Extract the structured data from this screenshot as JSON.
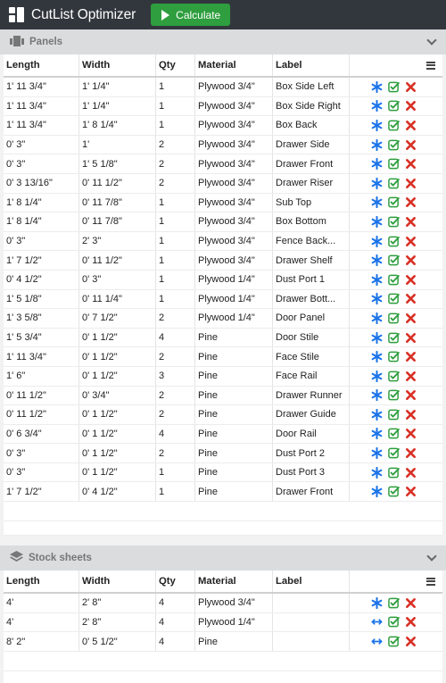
{
  "app": {
    "title": "CutList Optimizer",
    "calculate_label": "Calculate"
  },
  "panels": {
    "title": "Panels",
    "columns": [
      "Length",
      "Width",
      "Qty",
      "Material",
      "Label"
    ],
    "rows": [
      {
        "length": "1' 11 3/4\"",
        "width": "1' 1/4\"",
        "qty": "1",
        "material": "Plywood 3/4\"",
        "label": "Box Side Left"
      },
      {
        "length": "1' 11 3/4\"",
        "width": "1' 1/4\"",
        "qty": "1",
        "material": "Plywood 3/4\"",
        "label": "Box Side Right"
      },
      {
        "length": "1' 11 3/4\"",
        "width": "1' 8 1/4\"",
        "qty": "1",
        "material": "Plywood 3/4\"",
        "label": "Box Back"
      },
      {
        "length": "0' 3\"",
        "width": "1'",
        "qty": "2",
        "material": "Plywood 3/4\"",
        "label": "Drawer Side"
      },
      {
        "length": "0' 3\"",
        "width": "1' 5 1/8\"",
        "qty": "2",
        "material": "Plywood 3/4\"",
        "label": "Drawer Front"
      },
      {
        "length": "0' 3 13/16\"",
        "width": "0' 11 1/2\"",
        "qty": "2",
        "material": "Plywood 3/4\"",
        "label": "Drawer Riser"
      },
      {
        "length": "1' 8 1/4\"",
        "width": "0' 11 7/8\"",
        "qty": "1",
        "material": "Plywood 3/4\"",
        "label": "Sub Top"
      },
      {
        "length": "1' 8 1/4\"",
        "width": "0' 11 7/8\"",
        "qty": "1",
        "material": "Plywood 3/4\"",
        "label": "Box Bottom"
      },
      {
        "length": "0' 3\"",
        "width": "2' 3\"",
        "qty": "1",
        "material": "Plywood 3/4\"",
        "label": "Fence Back..."
      },
      {
        "length": "1' 7 1/2\"",
        "width": "0' 11 1/2\"",
        "qty": "1",
        "material": "Plywood 3/4\"",
        "label": "Drawer Shelf"
      },
      {
        "length": "0' 4 1/2\"",
        "width": "0' 3\"",
        "qty": "1",
        "material": "Plywood 1/4\"",
        "label": "Dust Port 1"
      },
      {
        "length": "1' 5 1/8\"",
        "width": "0' 11 1/4\"",
        "qty": "1",
        "material": "Plywood 1/4\"",
        "label": "Drawer Bott..."
      },
      {
        "length": "1' 3 5/8\"",
        "width": "0' 7 1/2\"",
        "qty": "2",
        "material": "Plywood 1/4\"",
        "label": "Door Panel"
      },
      {
        "length": "1' 5 3/4\"",
        "width": "0' 1 1/2\"",
        "qty": "4",
        "material": "Pine",
        "label": "Door Stile"
      },
      {
        "length": "1' 11 3/4\"",
        "width": "0' 1 1/2\"",
        "qty": "2",
        "material": "Pine",
        "label": "Face Stile"
      },
      {
        "length": "1' 6\"",
        "width": "0' 1 1/2\"",
        "qty": "3",
        "material": "Pine",
        "label": "Face Rail"
      },
      {
        "length": "0' 11 1/2\"",
        "width": "0' 3/4\"",
        "qty": "2",
        "material": "Pine",
        "label": "Drawer Runner"
      },
      {
        "length": "0' 11 1/2\"",
        "width": "0' 1 1/2\"",
        "qty": "2",
        "material": "Pine",
        "label": "Drawer Guide"
      },
      {
        "length": "0' 6 3/4\"",
        "width": "0' 1 1/2\"",
        "qty": "4",
        "material": "Pine",
        "label": "Door Rail"
      },
      {
        "length": "0' 3\"",
        "width": "0' 1 1/2\"",
        "qty": "2",
        "material": "Pine",
        "label": "Dust Port 2"
      },
      {
        "length": "0' 3\"",
        "width": "0' 1 1/2\"",
        "qty": "1",
        "material": "Pine",
        "label": "Dust Port 3"
      },
      {
        "length": "1' 7 1/2\"",
        "width": "0' 4 1/2\"",
        "qty": "1",
        "material": "Pine",
        "label": "Drawer Front"
      }
    ]
  },
  "stock": {
    "title": "Stock sheets",
    "columns": [
      "Length",
      "Width",
      "Qty",
      "Material",
      "Label"
    ],
    "rows": [
      {
        "length": "4'",
        "width": "2' 8\"",
        "qty": "4",
        "material": "Plywood 3/4\"",
        "label": "",
        "grain_icon": "asterisk-icon"
      },
      {
        "length": "4'",
        "width": "2' 8\"",
        "qty": "4",
        "material": "Plywood 1/4\"",
        "label": "",
        "grain_icon": "horizontal-arrow-icon"
      },
      {
        "length": "8' 2\"",
        "width": "0' 5 1/2\"",
        "qty": "4",
        "material": "Pine",
        "label": "",
        "grain_icon": "horizontal-arrow-icon"
      }
    ]
  },
  "colors": {
    "topbar": "#32373d",
    "calculate": "#2e9e3e",
    "asterisk": "#1a73e8",
    "check": "#2e9e3e",
    "delete": "#d93025"
  }
}
